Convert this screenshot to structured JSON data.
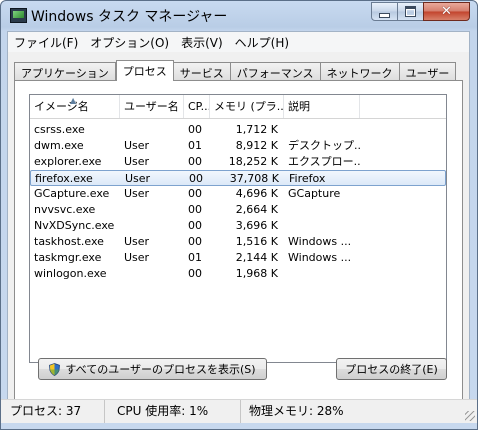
{
  "window": {
    "title": "Windows タスク マネージャー"
  },
  "titlebar": {
    "min": "minimize",
    "max": "maximize",
    "close": "✕"
  },
  "menu": [
    {
      "label": "ファイル(F)"
    },
    {
      "label": "オプション(O)"
    },
    {
      "label": "表示(V)"
    },
    {
      "label": "ヘルプ(H)"
    }
  ],
  "tabs": [
    {
      "label": "アプリケーション"
    },
    {
      "label": "プロセス"
    },
    {
      "label": "サービス"
    },
    {
      "label": "パフォーマンス"
    },
    {
      "label": "ネットワーク"
    },
    {
      "label": "ユーザー"
    }
  ],
  "active_tab": "プロセス",
  "process_list": {
    "columns": [
      "イメージ名",
      "ユーザー名",
      "CP...",
      "メモリ (プラ...",
      "説明"
    ],
    "sorted_column": "イメージ名",
    "selected_row": "firefox.exe",
    "rows": [
      {
        "name": "csrss.exe",
        "user": "",
        "cpu": "00",
        "mem": "1,712 K",
        "desc": ""
      },
      {
        "name": "dwm.exe",
        "user": "User",
        "cpu": "01",
        "mem": "8,912 K",
        "desc": "デスクトップ..."
      },
      {
        "name": "explorer.exe",
        "user": "User",
        "cpu": "00",
        "mem": "18,252 K",
        "desc": "エクスプロー..."
      },
      {
        "name": "firefox.exe",
        "user": "User",
        "cpu": "00",
        "mem": "37,708 K",
        "desc": "Firefox"
      },
      {
        "name": "GCapture.exe",
        "user": "User",
        "cpu": "00",
        "mem": "4,696 K",
        "desc": "GCapture"
      },
      {
        "name": "nvvsvc.exe",
        "user": "",
        "cpu": "00",
        "mem": "2,664 K",
        "desc": ""
      },
      {
        "name": "NvXDSync.exe",
        "user": "",
        "cpu": "00",
        "mem": "3,696 K",
        "desc": ""
      },
      {
        "name": "taskhost.exe",
        "user": "User",
        "cpu": "00",
        "mem": "1,516 K",
        "desc": "Windows ..."
      },
      {
        "name": "taskmgr.exe",
        "user": "User",
        "cpu": "01",
        "mem": "2,144 K",
        "desc": "Windows ..."
      },
      {
        "name": "winlogon.exe",
        "user": "",
        "cpu": "00",
        "mem": "1,968 K",
        "desc": ""
      }
    ]
  },
  "buttons": {
    "show_all": "すべてのユーザーのプロセスを表示(S)",
    "end_process": "プロセスの終了(E)"
  },
  "icons": {
    "app": "task-manager-icon",
    "uac": "uac-shield-icon",
    "sort": "sort-ascending-icon"
  },
  "status": {
    "processes": "プロセス: 37",
    "cpu": "CPU 使用率: 1%",
    "memory": "物理メモリ: 28%"
  },
  "colors": {
    "selection_border": "#7da2ce",
    "titlebar": "#c8daf0",
    "close_button": "#c2432c"
  }
}
